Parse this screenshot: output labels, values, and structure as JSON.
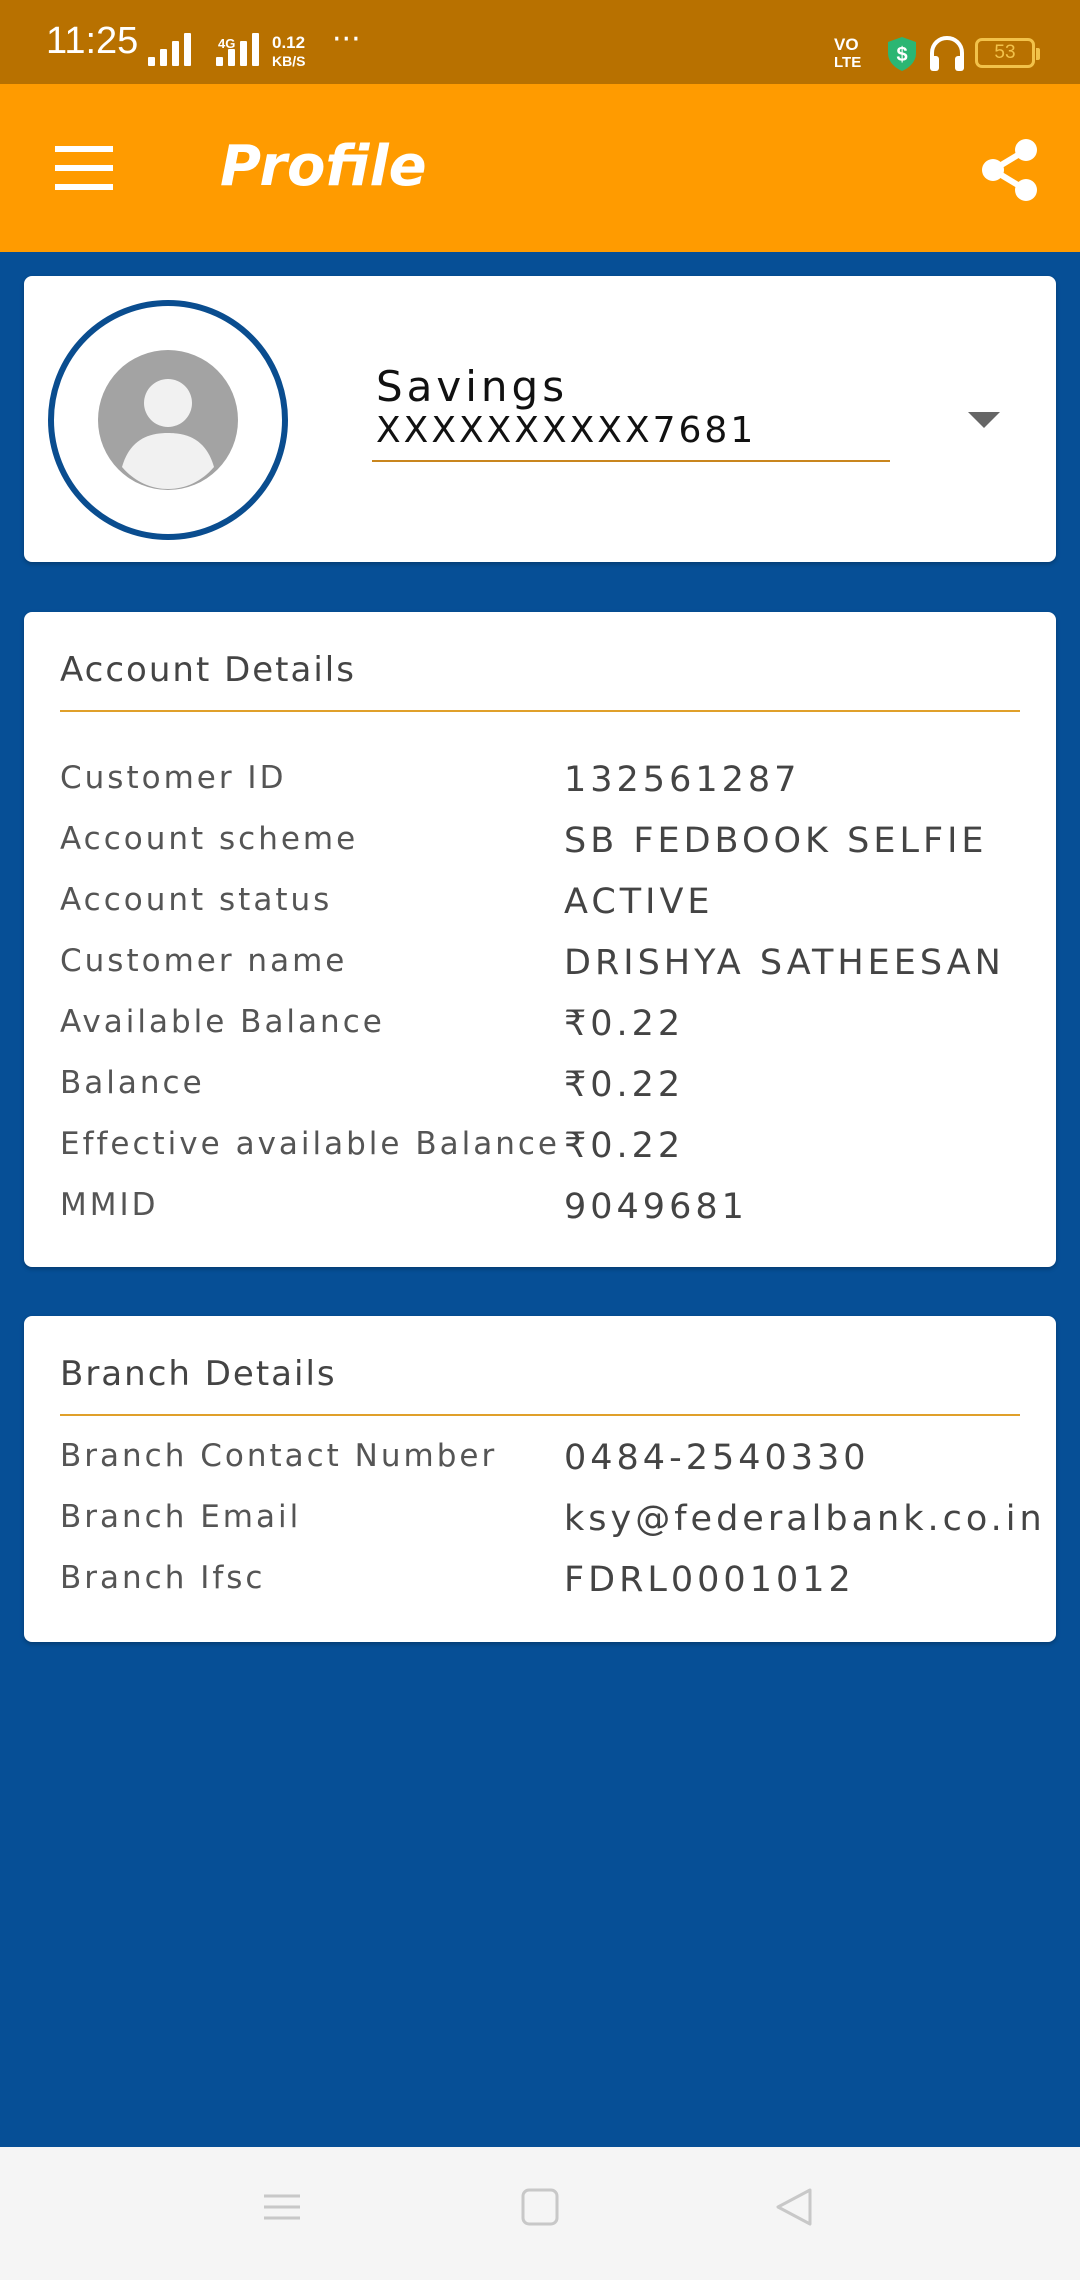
{
  "status_bar": {
    "time": "11:25",
    "net_tag": "4G",
    "speed_value": "0.12",
    "speed_unit": "KB/S",
    "more": "···",
    "volte_top": "VO",
    "volte_bottom": "LTE",
    "battery": "53"
  },
  "app_bar": {
    "title": "Profile",
    "menu_icon": "hamburger-menu-icon",
    "share_icon": "share-icon"
  },
  "account_selector": {
    "type": "Savings",
    "number": "XXXXXXXXXX7681",
    "avatar_icon": "user-avatar-icon"
  },
  "account_details": {
    "title": "Account Details",
    "rows": [
      {
        "label": "Customer ID",
        "value": "132561287"
      },
      {
        "label": "Account scheme",
        "value": "SB FEDBOOK SELFIE"
      },
      {
        "label": "Account status",
        "value": "ACTIVE"
      },
      {
        "label": "Customer name",
        "value": "DRISHYA SATHEESAN"
      },
      {
        "label": "Available Balance",
        "value": "₹0.22"
      },
      {
        "label": "Balance",
        "value": "₹0.22"
      },
      {
        "label": "Effective available Balance",
        "value": "₹0.22"
      },
      {
        "label": "MMID",
        "value": "9049681"
      }
    ]
  },
  "branch_details": {
    "title": "Branch Details",
    "rows": [
      {
        "label": "Branch Contact Number",
        "value": "0484-2540330"
      },
      {
        "label": "Branch Email",
        "value": "ksy@federalbank.co.in"
      },
      {
        "label": "Branch Ifsc",
        "value": "FDRL0001012"
      }
    ]
  },
  "colors": {
    "status_bar": "#b87100",
    "app_bar": "#ff9b00",
    "background": "#064f96",
    "divider": "#e0a02a"
  }
}
